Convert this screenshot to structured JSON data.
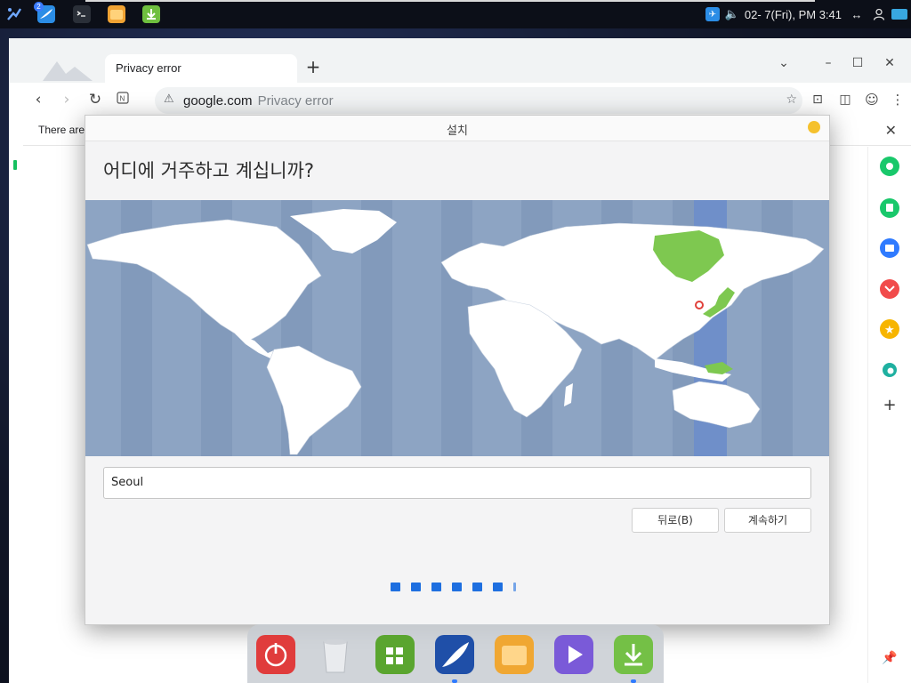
{
  "topbar": {
    "badge_count": "2",
    "clock": "02- 7(Fri), PM 3:41",
    "icons": [
      "satellite-app-icon",
      "deepin-browser-icon",
      "terminal-icon",
      "file-manager-icon",
      "installer-icon"
    ],
    "tray_icons": [
      "network-icon",
      "volume-icon",
      "resize-icon",
      "user-icon",
      "desktop-icon"
    ]
  },
  "browser": {
    "tab_title": "Privacy error",
    "omnibox_host": "google.com",
    "omnibox_path": "Privacy error",
    "infobar_text": "There are",
    "accent": "#1a73e8"
  },
  "installer": {
    "window_title": "설치",
    "heading": "어디에 거주하고 계십니까?",
    "timezone_value": "Seoul",
    "back_label": "뒤로(B)",
    "continue_label": "계속하기",
    "step_count": 7,
    "highlight_color": "#7ec850",
    "map_ocean_color": "#8da4c3",
    "selected_marker_color": "#e0403a"
  },
  "dock": {
    "items": [
      "power-icon",
      "trash-icon",
      "app-store-icon",
      "browser-icon",
      "file-manager-icon",
      "video-player-icon",
      "installer-icon"
    ]
  }
}
